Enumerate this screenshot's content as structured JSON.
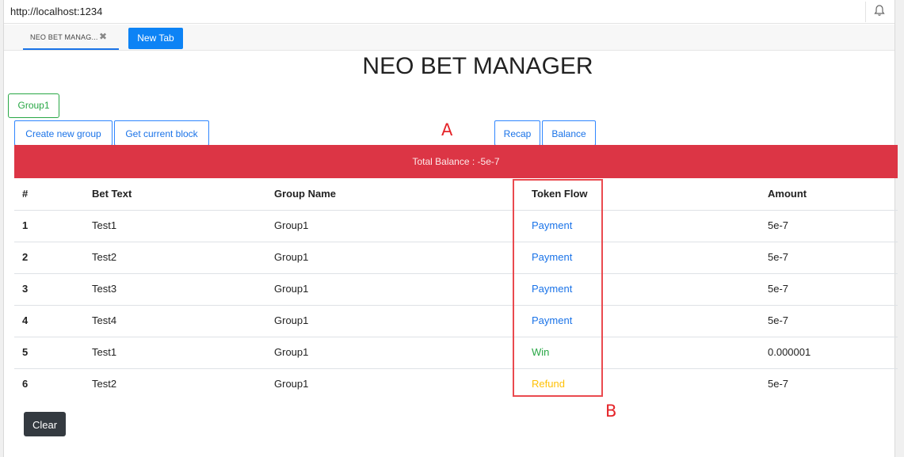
{
  "browser": {
    "url": "http://localhost:1234",
    "tabs": [
      {
        "label": "NEO BET MANAG...",
        "close": "✖"
      },
      {
        "label": "New Tab"
      }
    ],
    "bell_icon": "bell-icon"
  },
  "page": {
    "title": "NEO BET MANAGER",
    "group_tab": "Group1",
    "buttons": {
      "create_group": "Create new group",
      "current_block": "Get current block",
      "recap": "Recap",
      "balance": "Balance"
    },
    "annotations": {
      "a": "A",
      "b": "B"
    },
    "total_balance": "Total Balance : -5e-7",
    "table": {
      "headers": [
        "#",
        "Bet Text",
        "Group Name",
        "Token Flow",
        "Amount"
      ],
      "rows": [
        {
          "num": "1",
          "bet_text": "Test1",
          "group": "Group1",
          "flow": "Payment",
          "amount": "5e-7"
        },
        {
          "num": "2",
          "bet_text": "Test2",
          "group": "Group1",
          "flow": "Payment",
          "amount": "5e-7"
        },
        {
          "num": "3",
          "bet_text": "Test3",
          "group": "Group1",
          "flow": "Payment",
          "amount": "5e-7"
        },
        {
          "num": "4",
          "bet_text": "Test4",
          "group": "Group1",
          "flow": "Payment",
          "amount": "5e-7"
        },
        {
          "num": "5",
          "bet_text": "Test1",
          "group": "Group1",
          "flow": "Win",
          "amount": "0.000001"
        },
        {
          "num": "6",
          "bet_text": "Test2",
          "group": "Group1",
          "flow": "Refund",
          "amount": "5e-7"
        }
      ]
    },
    "clear": "Clear"
  },
  "colors": {
    "payment": "#1a73e8",
    "win": "#28a745",
    "refund": "#ffc107",
    "danger": "#dc3545",
    "annotation": "#e5252a"
  }
}
